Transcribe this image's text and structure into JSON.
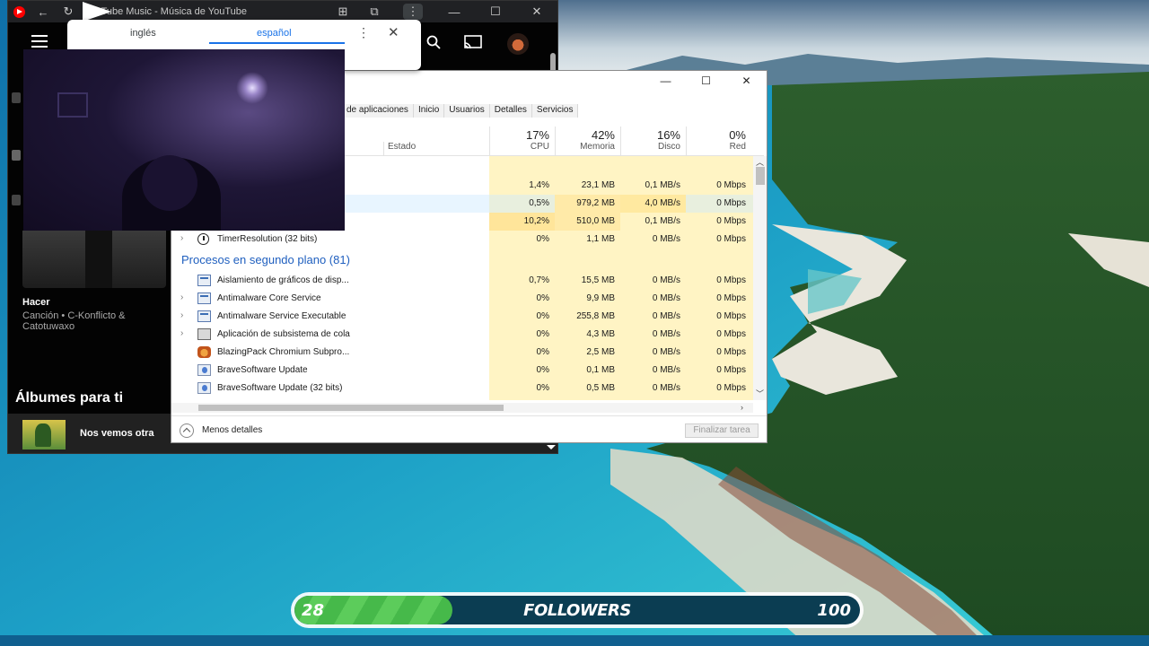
{
  "browser": {
    "title": "YouTube Music - Música de YouTube"
  },
  "translate": {
    "source_lang": "inglés",
    "target_lang": "español",
    "more_icon": "⋮",
    "close_icon": "✕"
  },
  "yt_music": {
    "song_title": "Hacer",
    "song_subtitle": "Canción • C-Konflicto & Catotuwaxo",
    "section_title": "Álbumes para ti",
    "now_playing": "Nos vemos otra"
  },
  "taskmgr": {
    "window_controls": {
      "minimize": "—",
      "maximize": "☐",
      "close": "✕"
    },
    "tabs": [
      "de aplicaciones",
      "Inicio",
      "Usuarios",
      "Detalles",
      "Servicios"
    ],
    "columns": {
      "status_label": "Estado",
      "cpu": {
        "pct": "17%",
        "label": "CPU"
      },
      "mem": {
        "pct": "42%",
        "label": "Memoria"
      },
      "disk": {
        "pct": "16%",
        "label": "Disco"
      },
      "net": {
        "pct": "0%",
        "label": "Red"
      }
    },
    "top_rows": [
      {
        "cpu": "1,4%",
        "mem": "23,1 MB",
        "disk": "0,1 MB/s",
        "net": "0 Mbps"
      },
      {
        "cpu": "0,5%",
        "mem": "979,2 MB",
        "disk": "4,0 MB/s",
        "net": "0 Mbps"
      },
      {
        "cpu": "10,2%",
        "mem": "510,0 MB",
        "disk": "0,1 MB/s",
        "net": "0 Mbps"
      },
      {
        "name": "TimerResolution (32 bits)",
        "cpu": "0%",
        "mem": "1,1 MB",
        "disk": "0 MB/s",
        "net": "0 Mbps"
      }
    ],
    "group_title": "Procesos en segundo plano (81)",
    "background_rows": [
      {
        "name": "Aislamiento de gráficos de disp...",
        "cpu": "0,7%",
        "mem": "15,5 MB",
        "disk": "0 MB/s",
        "net": "0 Mbps"
      },
      {
        "name": "Antimalware Core Service",
        "cpu": "0%",
        "mem": "9,9 MB",
        "disk": "0 MB/s",
        "net": "0 Mbps"
      },
      {
        "name": "Antimalware Service Executable",
        "cpu": "0%",
        "mem": "255,8 MB",
        "disk": "0 MB/s",
        "net": "0 Mbps"
      },
      {
        "name": "Aplicación de subsistema de cola",
        "cpu": "0%",
        "mem": "4,3 MB",
        "disk": "0 MB/s",
        "net": "0 Mbps"
      },
      {
        "name": "BlazingPack Chromium Subpro...",
        "cpu": "0%",
        "mem": "2,5 MB",
        "disk": "0 MB/s",
        "net": "0 Mbps"
      },
      {
        "name": "BraveSoftware Update",
        "cpu": "0%",
        "mem": "0,1 MB",
        "disk": "0 MB/s",
        "net": "0 Mbps"
      },
      {
        "name": "BraveSoftware Update (32 bits)",
        "cpu": "0%",
        "mem": "0,5 MB",
        "disk": "0 MB/s",
        "net": "0 Mbps"
      }
    ],
    "less_details": "Menos detalles",
    "end_task": "Finalizar tarea"
  },
  "followers_goal": {
    "current": "28",
    "label": "FOLLOWERS",
    "target": "100",
    "progress_fraction": 0.28
  }
}
